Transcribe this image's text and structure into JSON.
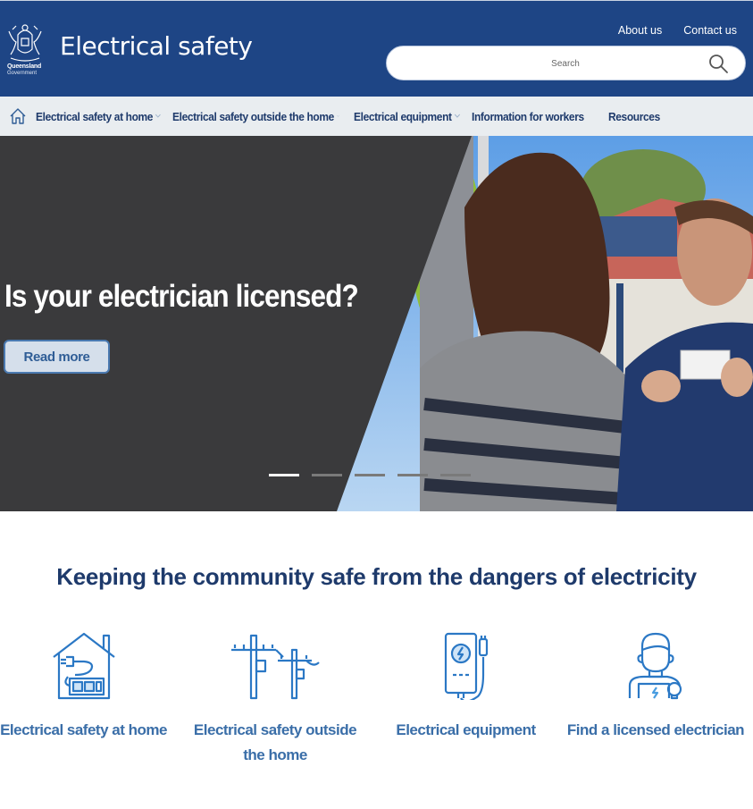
{
  "header": {
    "logo": {
      "line1": "Queensland",
      "line2": "Government"
    },
    "site_title": "Electrical safety",
    "top_links": [
      {
        "label": "About us"
      },
      {
        "label": "Contact us"
      }
    ],
    "search": {
      "placeholder": "Search",
      "value": ""
    }
  },
  "nav": {
    "home_icon": "home-icon",
    "items": [
      {
        "label": "Electrical safety at home",
        "has_dropdown": true
      },
      {
        "label": "Electrical safety outside the home",
        "has_dropdown": true
      },
      {
        "label": "Electrical equipment",
        "has_dropdown": true
      },
      {
        "label": "Information for workers",
        "has_dropdown": false
      },
      {
        "label": "Resources",
        "has_dropdown": false
      }
    ]
  },
  "hero": {
    "title": "Is your electrician licensed?",
    "button_label": "Read more",
    "slides_total": 5,
    "active_slide": 1
  },
  "main": {
    "title": "Keeping the community safe from the dangers of electricity",
    "cards": [
      {
        "label": "Electrical safety at home",
        "icon": "house-plug-icon"
      },
      {
        "label": "Electrical safety outside the home",
        "icon": "power-poles-icon"
      },
      {
        "label": "Electrical equipment",
        "icon": "power-bank-icon"
      },
      {
        "label": "Find a licensed electrician",
        "icon": "electrician-icon"
      }
    ]
  },
  "colors": {
    "header_bg": "#1e4585",
    "nav_bg": "#e9edf0",
    "nav_text": "#1e3a6b",
    "hero_panel": "#3a3a3c",
    "accent_blue": "#3a6ea8",
    "icon_blue": "#2b78c5"
  }
}
